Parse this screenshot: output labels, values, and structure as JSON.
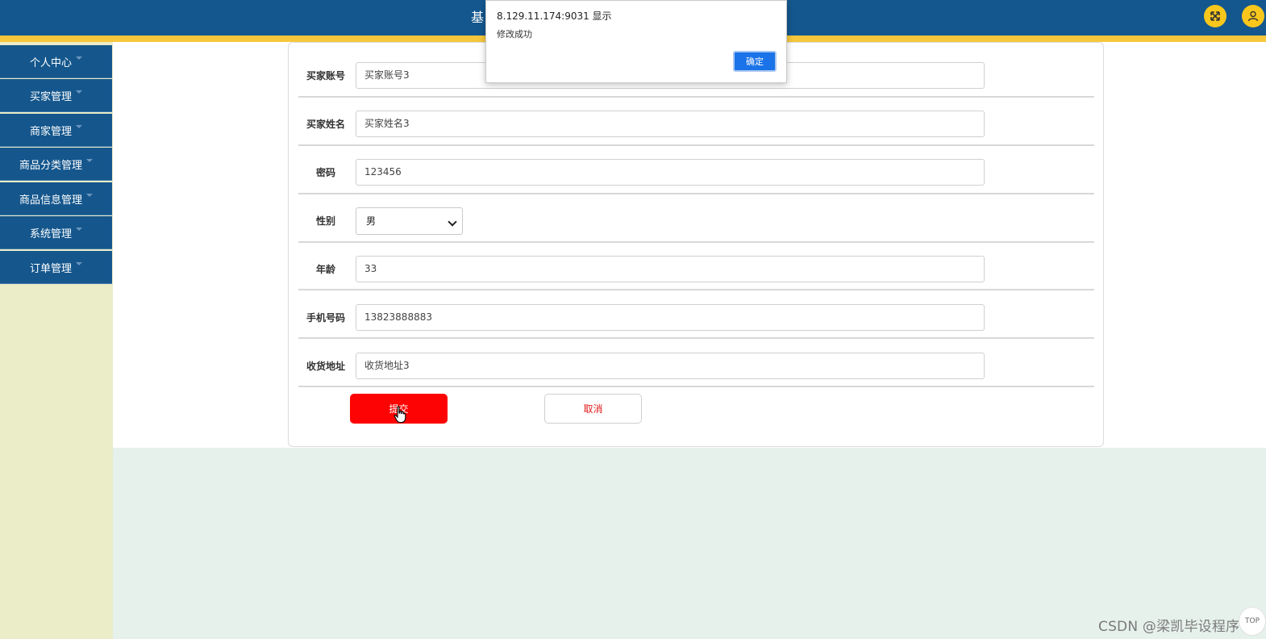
{
  "header": {
    "title": "基",
    "fullscreen_icon": "fullscreen-icon",
    "user_icon": "user-icon",
    "colors": {
      "bar": "#14578e",
      "stripe": "#f6c63c",
      "round_button": "#f9c71c"
    }
  },
  "sidebar": {
    "items": [
      {
        "label": "个人中心"
      },
      {
        "label": "买家管理"
      },
      {
        "label": "商家管理"
      },
      {
        "label": "商品分类管理"
      },
      {
        "label": "商品信息管理"
      },
      {
        "label": "系统管理"
      },
      {
        "label": "订单管理"
      }
    ]
  },
  "form": {
    "fields": [
      {
        "label": "买家账号",
        "value": "买家账号3"
      },
      {
        "label": "买家姓名",
        "value": "买家姓名3"
      },
      {
        "label": "密码",
        "value": "123456"
      },
      {
        "label": "性别",
        "value": "男"
      },
      {
        "label": "年龄",
        "value": "33"
      },
      {
        "label": "手机号码",
        "value": "13823888883"
      },
      {
        "label": "收货地址",
        "value": "收货地址3"
      }
    ],
    "submit_label": "提交",
    "cancel_label": "取消",
    "colors": {
      "submit": "#fd0303",
      "cancel_text": "#e01919"
    }
  },
  "dialog": {
    "title": "8.129.11.174:9031 显示",
    "message": "修改成功",
    "ok_label": "确定",
    "ok_color": "#1a73e8"
  },
  "watermark": {
    "text": "CSDN @梁凯毕设程序"
  },
  "back_to_top": {
    "label": "TOP"
  }
}
